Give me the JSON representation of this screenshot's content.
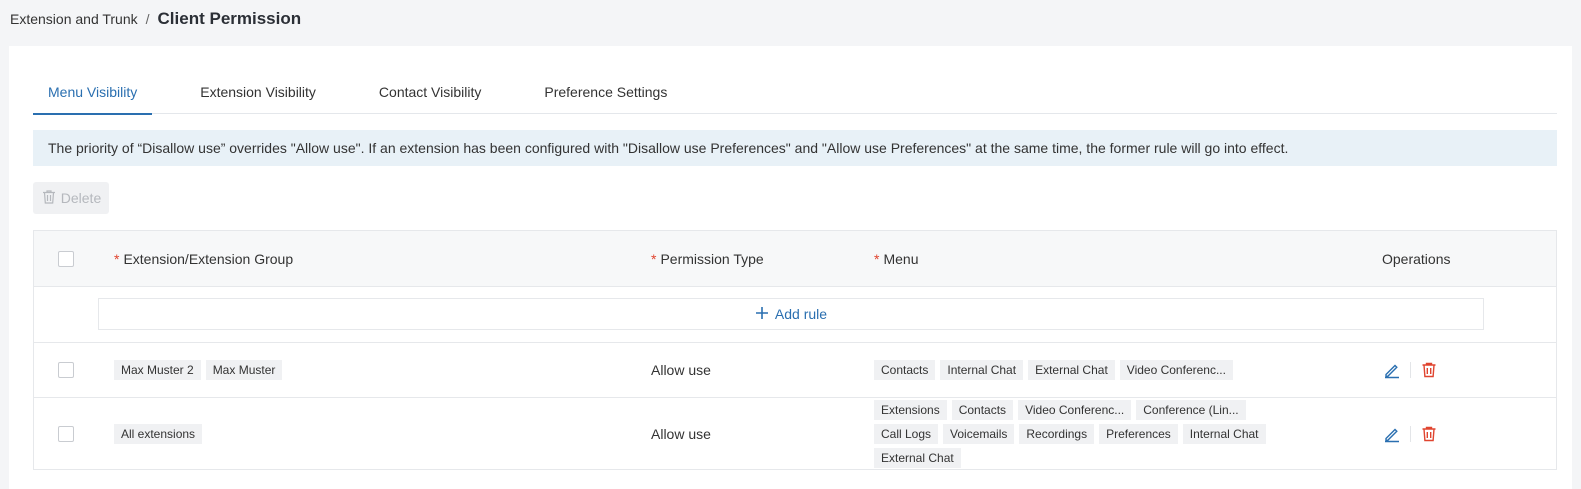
{
  "breadcrumb": {
    "parent": "Extension and Trunk",
    "separator": "/",
    "current": "Client Permission"
  },
  "tabs": [
    {
      "label": "Menu Visibility",
      "active": true
    },
    {
      "label": "Extension Visibility",
      "active": false
    },
    {
      "label": "Contact Visibility",
      "active": false
    },
    {
      "label": "Preference Settings",
      "active": false
    }
  ],
  "notice": "The priority of “Disallow use” overrides \"Allow use\". If an extension has been configured with \"Disallow use   Preferences\" and \"Allow use   Preferences\" at the same time, the former rule will go into effect.",
  "toolbar": {
    "delete_label": "Delete",
    "delete_icon": "trash-icon"
  },
  "table": {
    "headers": {
      "required_mark": "*",
      "extension": "Extension/Extension Group",
      "permission": "Permission Type",
      "menu": "Menu",
      "operations": "Operations"
    },
    "add_rule": "Add rule",
    "rows": [
      {
        "extensions": [
          "Max Muster 2",
          "Max Muster"
        ],
        "permission": "Allow use",
        "menus": [
          "Contacts",
          "Internal Chat",
          "External Chat",
          "Video Conferenc..."
        ]
      },
      {
        "extensions": [
          "All extensions"
        ],
        "permission": "Allow use",
        "menus": [
          "Extensions",
          "Contacts",
          "Video Conferenc...",
          "Conference (Lin...",
          "Call Logs",
          "Voicemails",
          "Recordings",
          "Preferences",
          "Internal Chat",
          "External Chat"
        ]
      }
    ]
  },
  "colors": {
    "accent": "#2a6fb0",
    "danger": "#e0442f",
    "notice_bg": "#e8f1f7"
  }
}
